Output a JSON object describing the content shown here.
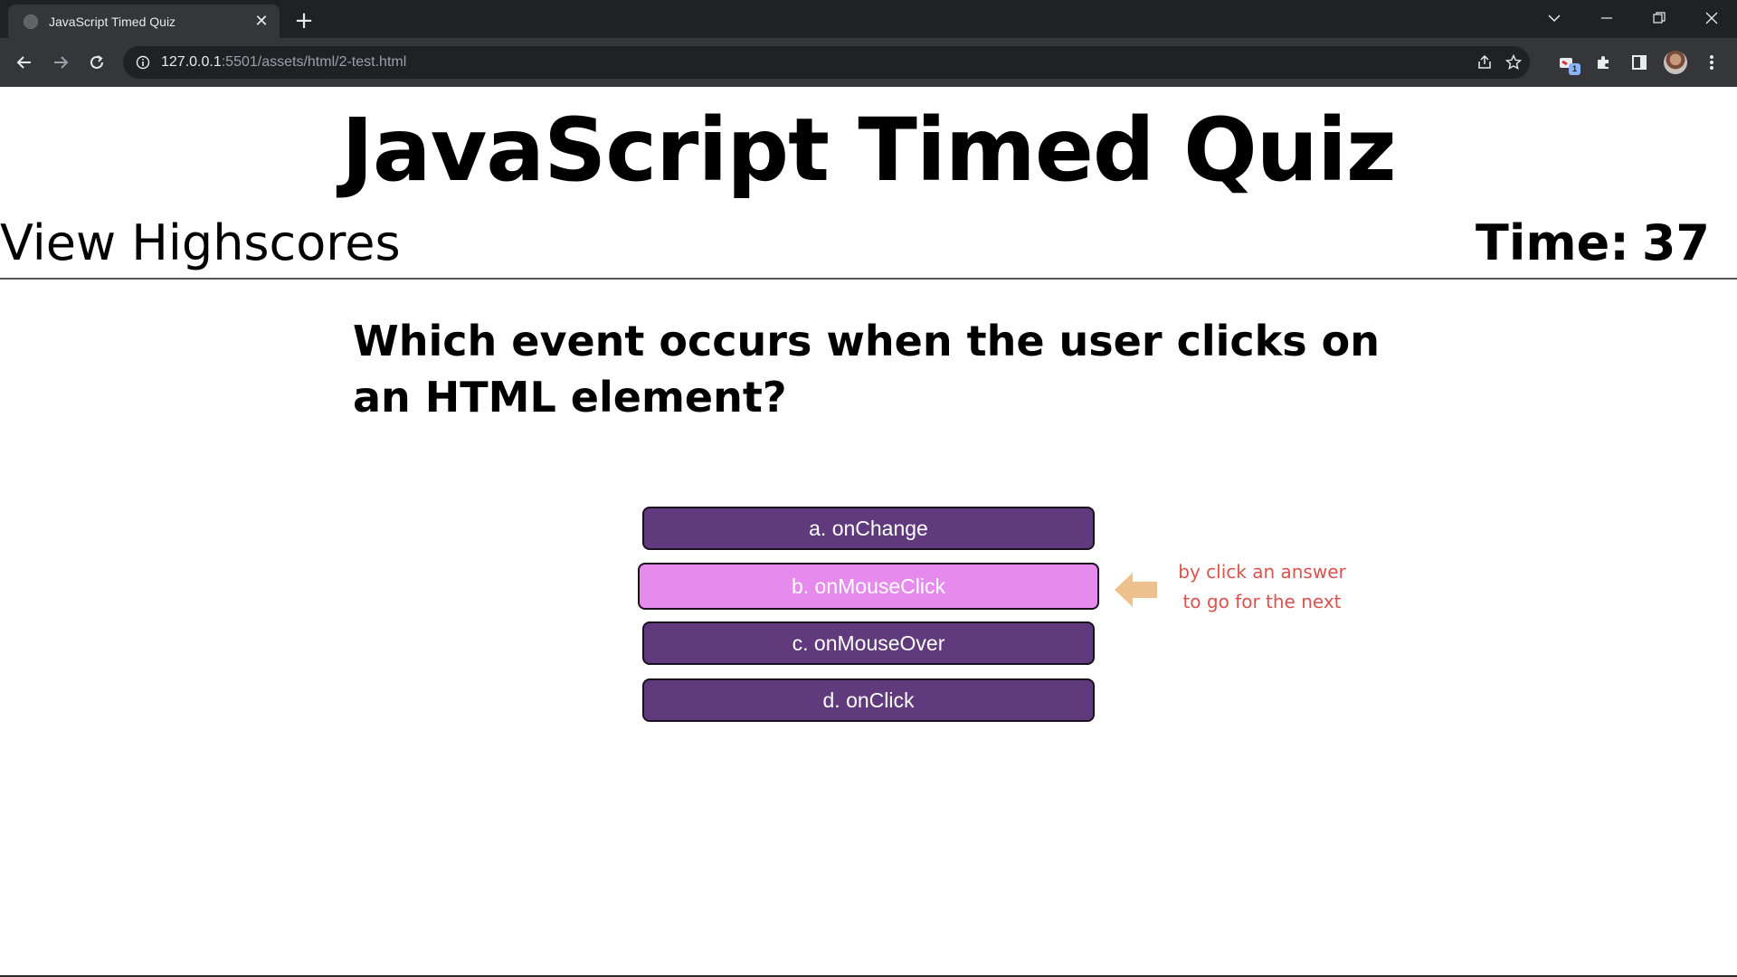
{
  "browser": {
    "tab_title": "JavaScript Timed Quiz",
    "url_host": "127.0.0.1",
    "url_path": ":5501/assets/html/2-test.html",
    "extension_badge": "1"
  },
  "page": {
    "title": "JavaScript Timed Quiz",
    "highscores_link": "View Highscores",
    "timer_label": "Time:",
    "timer_value": "37",
    "question": "Which event occurs when the user clicks on an HTML element?",
    "answers": [
      {
        "label": "a. onChange",
        "highlighted": false
      },
      {
        "label": "b. onMouseClick",
        "highlighted": true
      },
      {
        "label": "c. onMouseOver",
        "highlighted": false
      },
      {
        "label": "d. onClick",
        "highlighted": false
      }
    ],
    "hint_line1": "by click an answer",
    "hint_line2": "to go for the next"
  },
  "colors": {
    "answer_bg": "#603a7c",
    "answer_hover_bg": "#e68aee",
    "hint_text": "#d9534f",
    "hint_arrow": "#eec08d"
  }
}
